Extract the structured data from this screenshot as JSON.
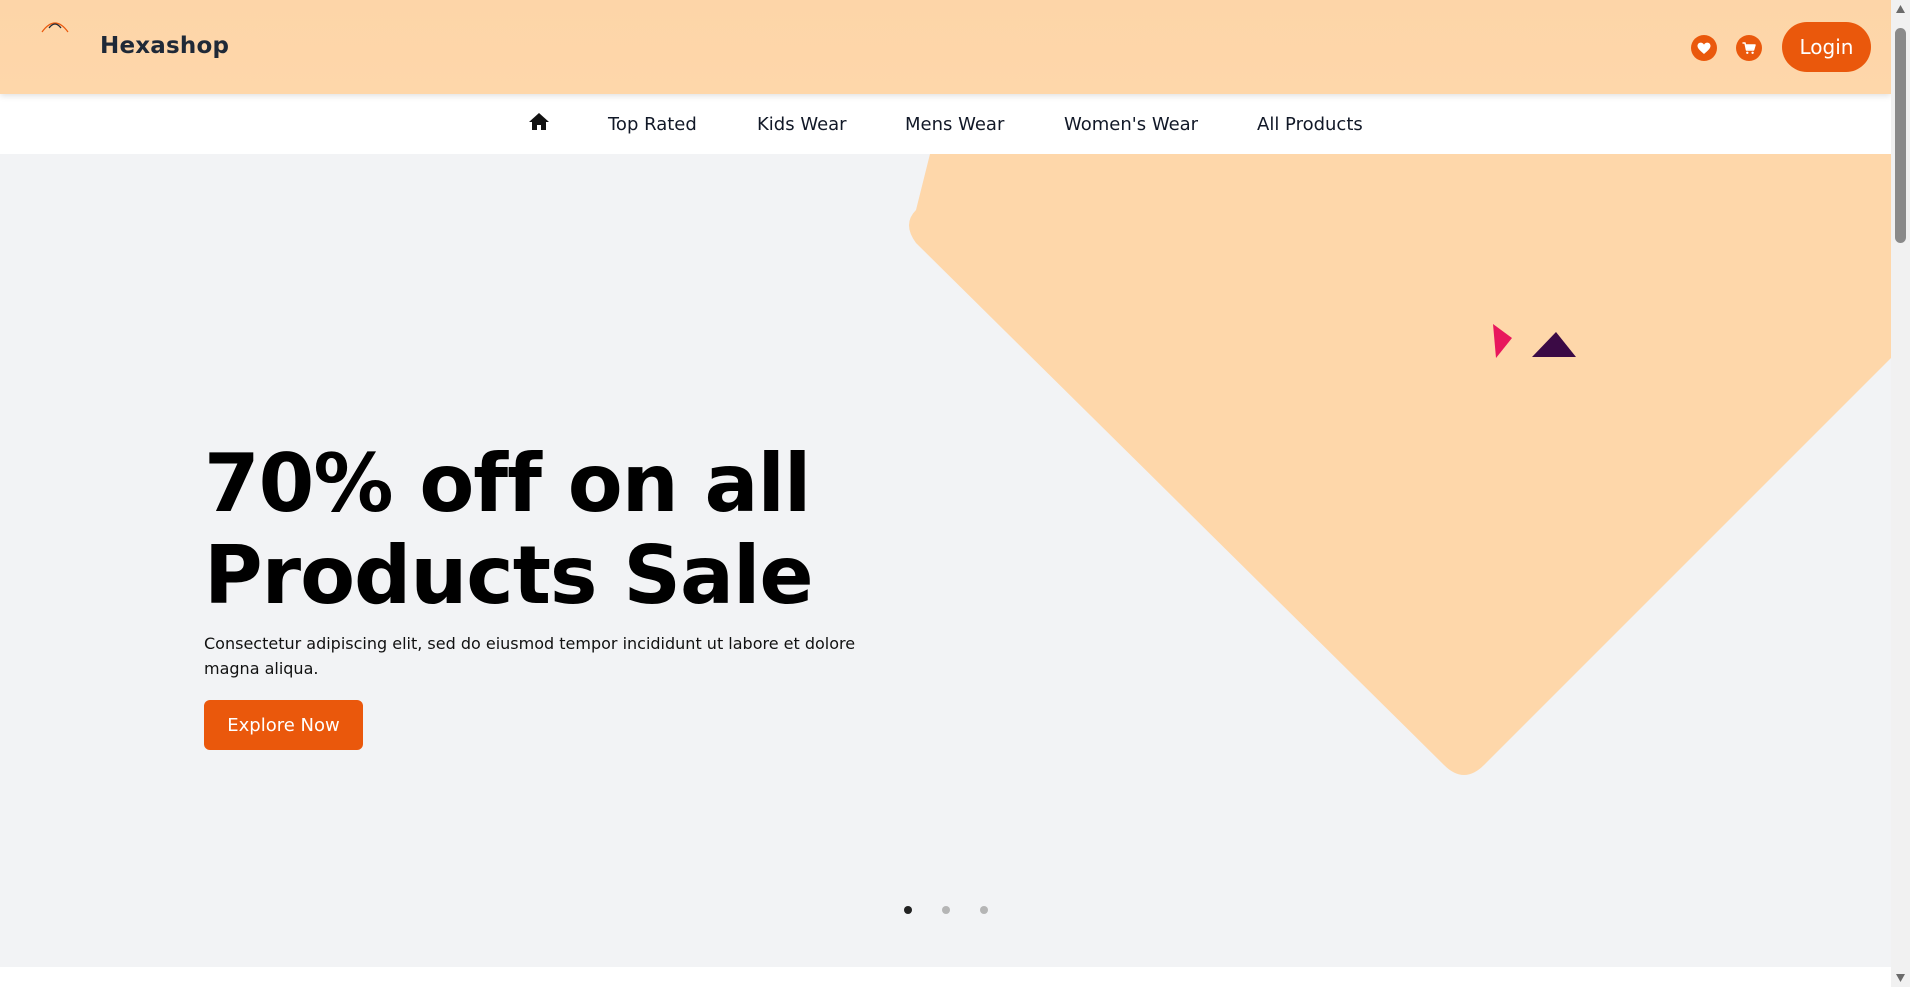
{
  "header": {
    "brand": "Hexashop",
    "login_label": "Login",
    "icons": [
      "logo-arc-icon",
      "heart-icon",
      "cart-icon"
    ]
  },
  "nav": {
    "home_icon": "home-icon",
    "links": [
      {
        "label": "Top Rated"
      },
      {
        "label": "Kids Wear"
      },
      {
        "label": "Mens Wear"
      },
      {
        "label": "Women's Wear"
      },
      {
        "label": "All Products"
      }
    ]
  },
  "hero": {
    "title_line1": "70% off on all",
    "title_line2": "Products Sale",
    "subtitle": "Consectetur adipiscing elit, sed do eiusmod tempor incididunt ut labore et dolore magna aliqua.",
    "cta_label": "Explore Now",
    "slides": 3,
    "active_slide": 1
  },
  "colors": {
    "header_bg": "#fed7aa",
    "accent": "#ea580c",
    "hero_bg": "#f2f3f5",
    "shape": "#fed7aa",
    "text": "#111827"
  }
}
